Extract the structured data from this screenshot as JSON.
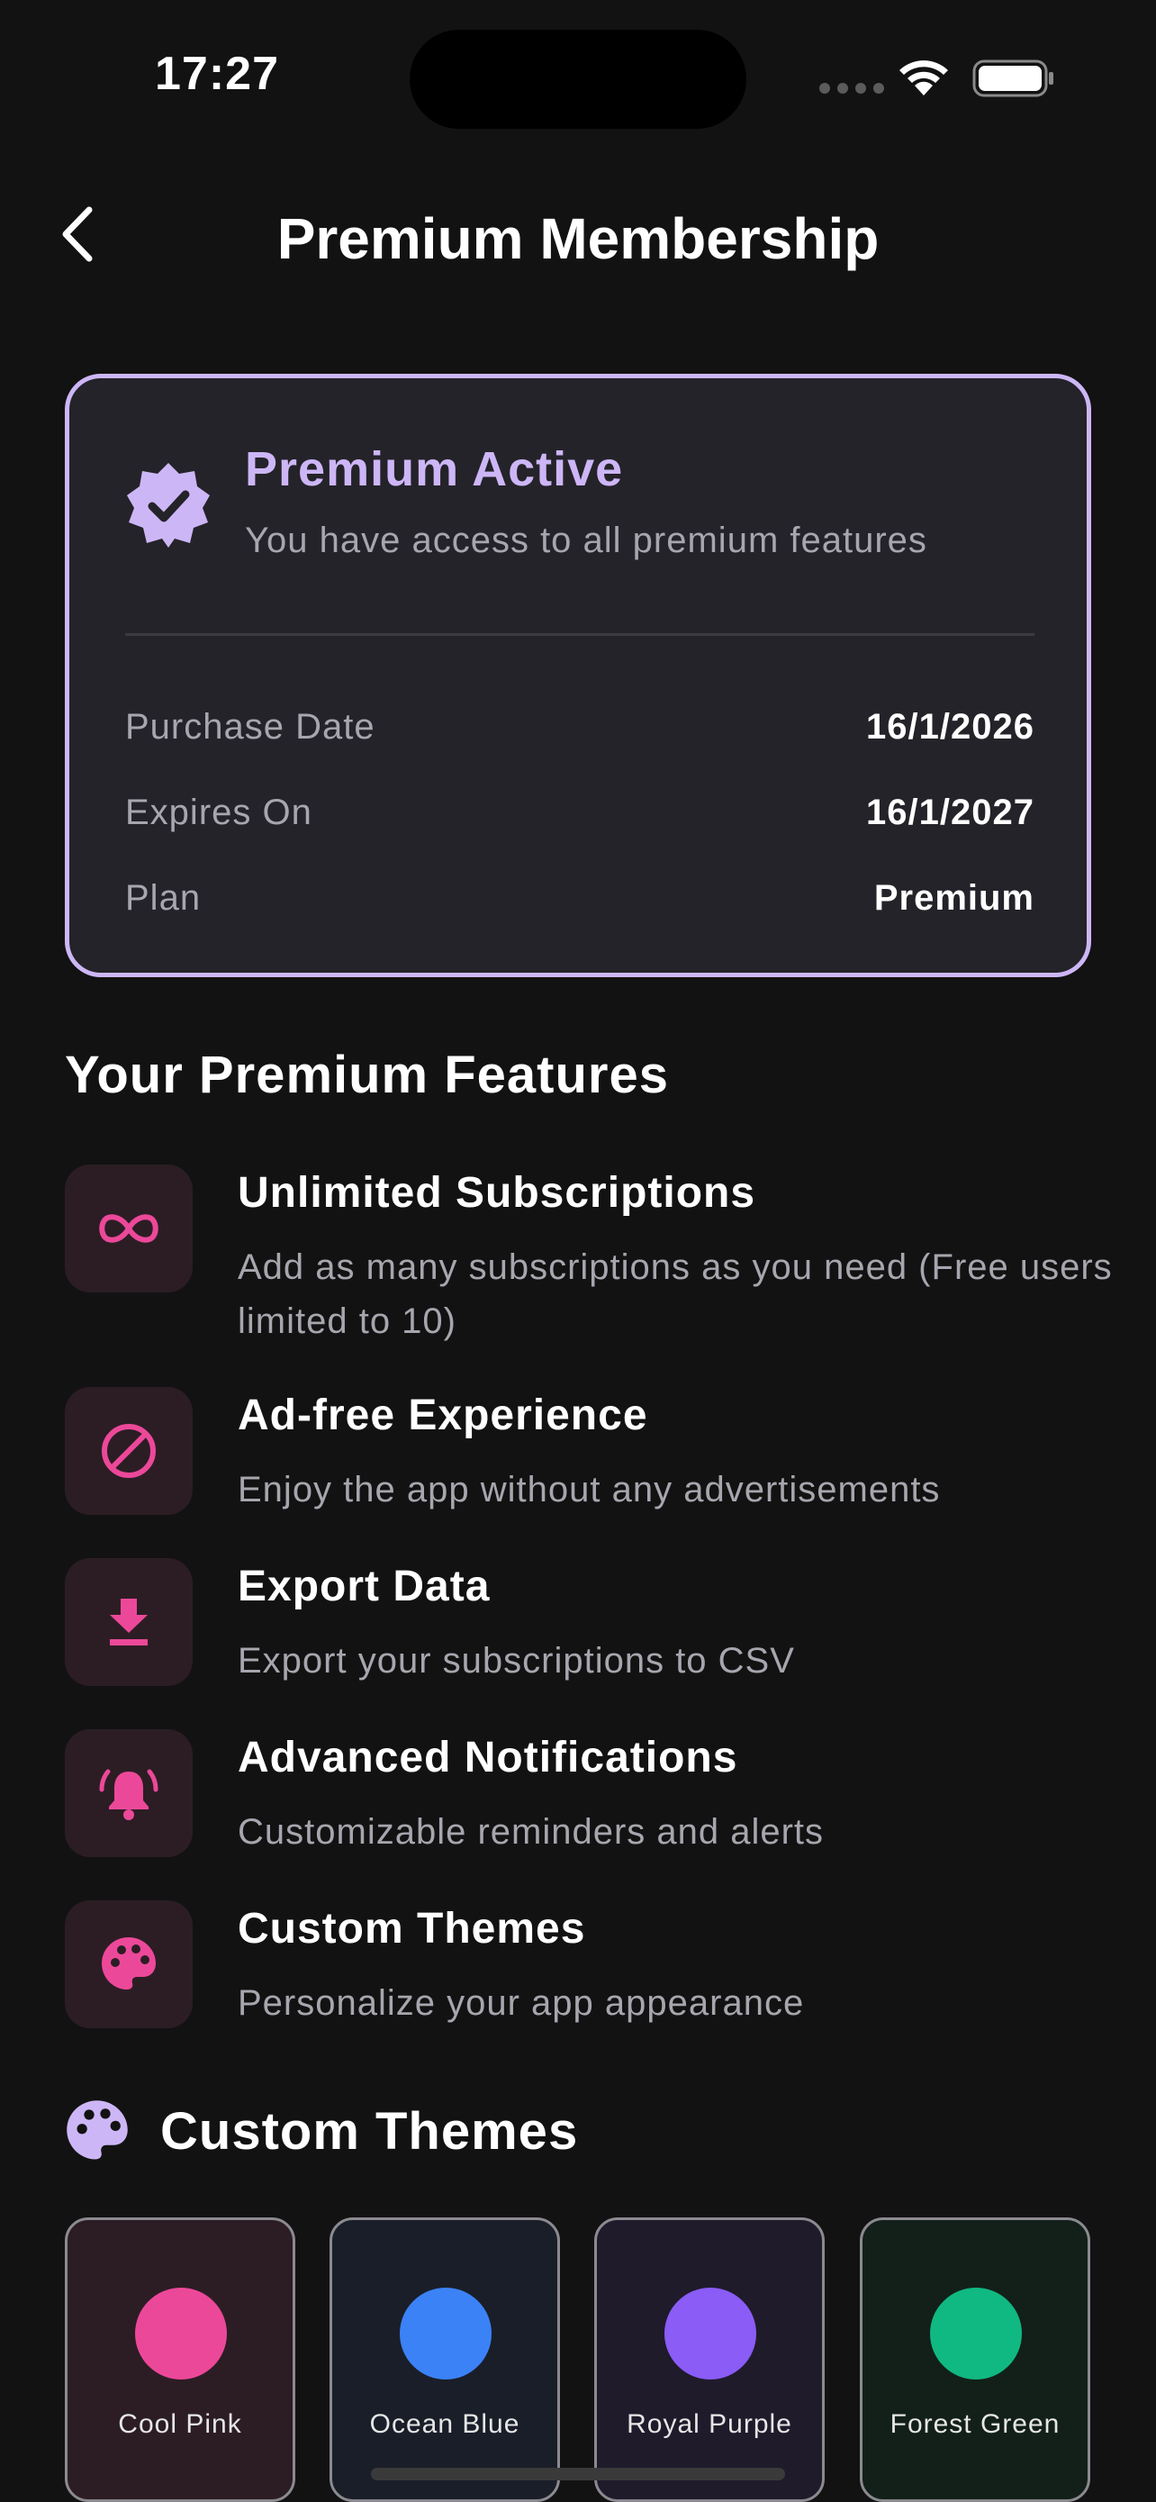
{
  "status_bar": {
    "time": "17:27"
  },
  "header": {
    "title": "Premium Membership"
  },
  "premium_card": {
    "title": "Premium Active",
    "subtitle": "You have access to all premium features",
    "rows": [
      {
        "label": "Purchase Date",
        "value": "16/1/2026"
      },
      {
        "label": "Expires On",
        "value": "16/1/2027"
      },
      {
        "label": "Plan",
        "value": "Premium"
      }
    ]
  },
  "features": {
    "section_title": "Your Premium Features",
    "items": [
      {
        "icon": "infinity-icon",
        "title": "Unlimited Subscriptions",
        "description": "Add as many subscriptions as you need (Free users limited to 10)"
      },
      {
        "icon": "block-icon",
        "title": "Ad-free Experience",
        "description": "Enjoy the app without any advertisements"
      },
      {
        "icon": "download-icon",
        "title": "Export Data",
        "description": "Export your subscriptions to CSV"
      },
      {
        "icon": "bell-ringing-icon",
        "title": "Advanced Notifications",
        "description": "Customizable reminders and alerts"
      },
      {
        "icon": "palette-icon",
        "title": "Custom Themes",
        "description": "Personalize your app appearance"
      }
    ]
  },
  "themes": {
    "section_title": "Custom Themes",
    "items": [
      {
        "name": "Cool Pink",
        "color": "#ec4899",
        "bg": "#2c1d24"
      },
      {
        "name": "Ocean Blue",
        "color": "#3b82f6",
        "bg": "#1a1e29"
      },
      {
        "name": "Royal Purple",
        "color": "#8b5cf6",
        "bg": "#1f1b2b"
      },
      {
        "name": "Forest Green",
        "color": "#10b981",
        "bg": "#122019"
      }
    ]
  },
  "colors": {
    "accent_purple": "#cdb6f6",
    "accent_pink": "#ec4899",
    "background": "#121212",
    "card": "#242329"
  }
}
